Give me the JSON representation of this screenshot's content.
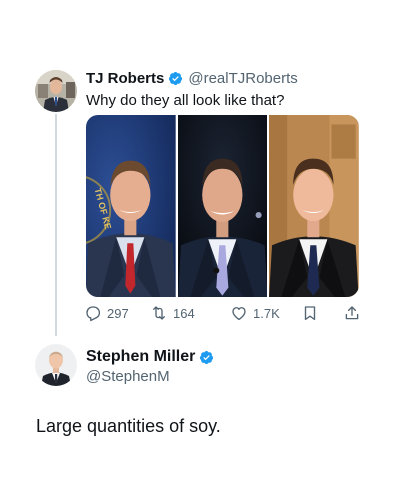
{
  "post": {
    "author_name": "TJ Roberts",
    "author_handle": "@realTJRoberts",
    "text": "Why do they all look like that?",
    "stats": {
      "replies": "297",
      "reposts": "164",
      "likes": "1.7K"
    },
    "icons": [
      "reply-icon",
      "repost-icon",
      "like-icon",
      "bookmark-icon",
      "share-icon"
    ],
    "photo_background_text": "TH OF KE"
  },
  "reply": {
    "author_name": "Stephen Miller",
    "author_handle": "@StephenM",
    "text": "Large quantities of soy."
  },
  "colors": {
    "verified_blue": "#1d9bf0",
    "text_primary": "#0f1419",
    "text_secondary": "#536471",
    "thread_line": "#cfd9de"
  }
}
